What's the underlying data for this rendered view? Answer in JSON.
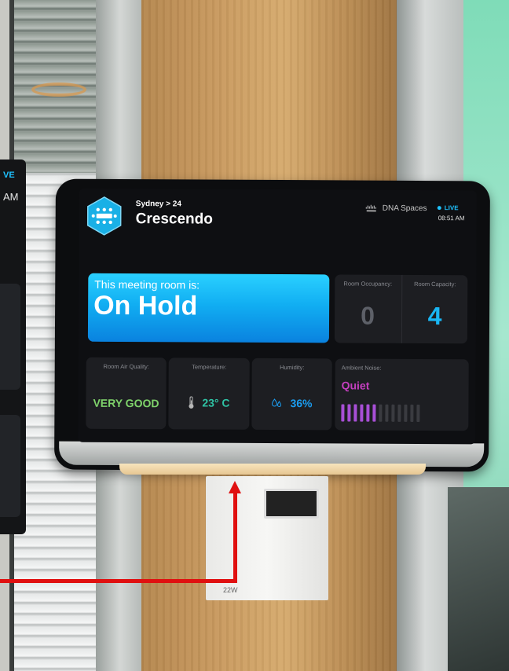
{
  "side_panel": {
    "live_label": "VE",
    "time_fragment": "AM"
  },
  "header": {
    "breadcrumb": "Sydney > 24",
    "room_name": "Crescendo",
    "room_icon": "meeting-room-icon",
    "brand_logo": "cisco-logo",
    "brand_name": "DNA Spaces",
    "live_label": "LIVE",
    "time": "08:51 AM"
  },
  "status": {
    "prefix": "This meeting room is:",
    "value": "On Hold"
  },
  "occupancy": {
    "occupancy_label": "Room Occupancy:",
    "occupancy_value": "0",
    "capacity_label": "Room Capacity:",
    "capacity_value": "4"
  },
  "environment": {
    "air_quality_label": "Room Air Quality:",
    "air_quality_value": "VERY GOOD",
    "temperature_label": "Temperature:",
    "temperature_value": "23° C",
    "temperature_icon": "thermometer-icon",
    "humidity_label": "Humidity:",
    "humidity_value": "36%",
    "humidity_icon": "water-drop-icon",
    "noise_label": "Ambient Noise:",
    "noise_value": "Quiet",
    "noise_level_bars_on": 6,
    "noise_level_bars_total": 13
  },
  "sensor": {
    "label": "22W"
  },
  "colors": {
    "status_card": "#11aef2",
    "live": "#1ec2ff",
    "air_quality": "#7fd36b",
    "temperature": "#2fc2a4",
    "humidity": "#1b9df0",
    "noise": "#c43fbf",
    "noise_bar_on": "#a84fd6",
    "annotation_arrow": "#e01010"
  }
}
